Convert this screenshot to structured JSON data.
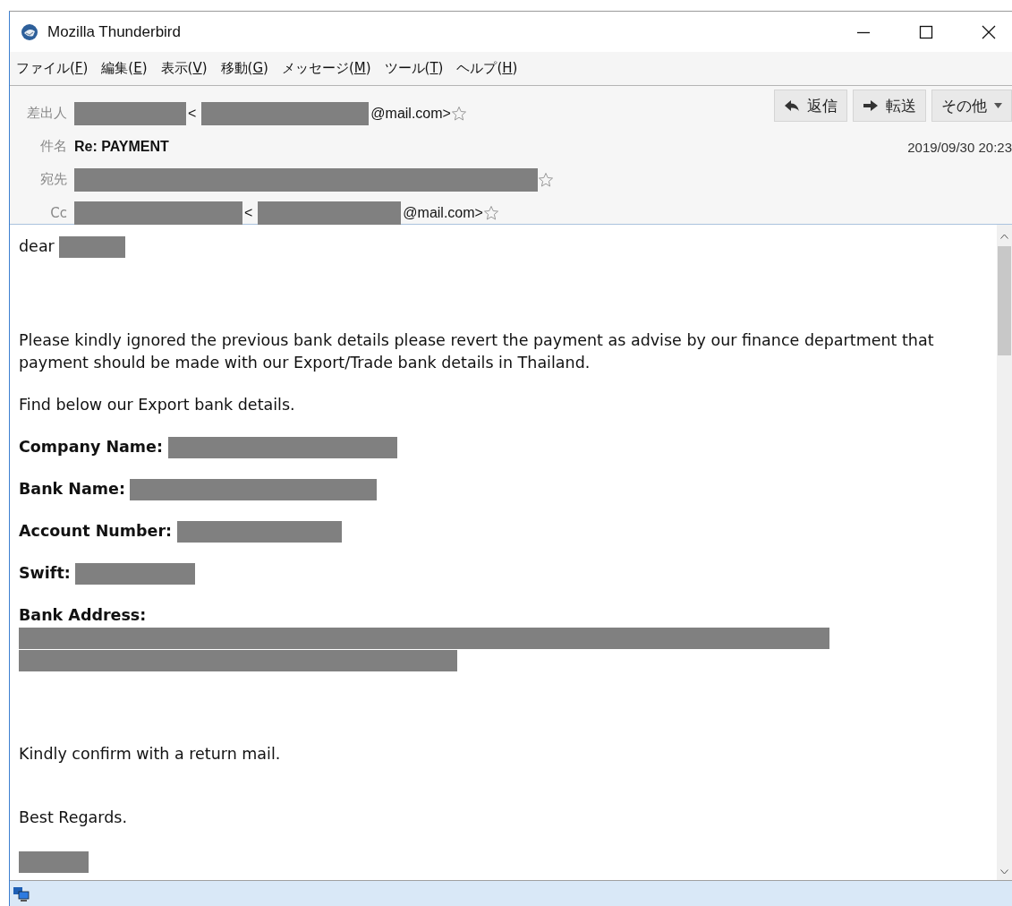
{
  "window": {
    "title": "Mozilla Thunderbird"
  },
  "menu": [
    "ファイル(F)",
    "編集(E)",
    "表示(V)",
    "移動(G)",
    "メッセージ(M)",
    "ツール(T)",
    "ヘルプ(H)"
  ],
  "header": {
    "fields": [
      {
        "label": "差出人",
        "starred": false,
        "parts": [
          {
            "kind": "redacted"
          },
          {
            "kind": "text",
            "text": "<"
          },
          {
            "kind": "redacted"
          },
          {
            "kind": "text",
            "text": "@mail.com>"
          }
        ]
      },
      {
        "label": "件名",
        "subject": "Re: PAYMENT",
        "date": "2019/09/30 20:23"
      },
      {
        "label": "宛先",
        "starred": false,
        "parts": [
          {
            "kind": "redacted"
          }
        ]
      },
      {
        "label": "Cc",
        "starred": false,
        "parts": [
          {
            "kind": "redacted"
          },
          {
            "kind": "text",
            "text": "<"
          },
          {
            "kind": "redacted"
          },
          {
            "kind": "text",
            "text": "@mail.com>"
          }
        ]
      }
    ],
    "buttons": [
      {
        "kind": "reply",
        "label": "返信"
      },
      {
        "kind": "forward",
        "label": "転送"
      },
      {
        "kind": "more",
        "label": "その他"
      }
    ]
  },
  "body": [
    {
      "kind": "greeting",
      "text": "dear"
    },
    {
      "kind": "text",
      "text": "Please kindly ignored the previous bank details please revert the payment as advise by our finance department that payment should be made with our Export/Trade bank details in Thailand."
    },
    {
      "kind": "text",
      "text": "Find below our Export bank details."
    },
    {
      "kind": "field",
      "label": "Company Name:"
    },
    {
      "kind": "field",
      "label": "Bank Name:"
    },
    {
      "kind": "field",
      "label": "Account Number:"
    },
    {
      "kind": "field",
      "label": "Swift:"
    },
    {
      "kind": "field",
      "label": "Bank Address:"
    },
    {
      "kind": "redacted"
    },
    {
      "kind": "text",
      "text": "Kindly confirm with a return mail."
    },
    {
      "kind": "text",
      "text": "Best Regards."
    },
    {
      "kind": "redacted"
    }
  ]
}
